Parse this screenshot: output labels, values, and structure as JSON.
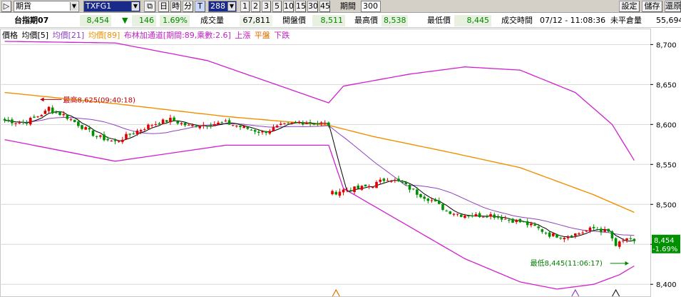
{
  "toolbar": {
    "market_select": "期貨",
    "symbol_select": "TXFG1",
    "interval_buttons": [
      "日",
      "時",
      "分",
      "T"
    ],
    "tick_select": "288",
    "minute_buttons": [
      "1",
      "2",
      "3",
      "5",
      "10",
      "15",
      "30",
      "45"
    ],
    "period_label": "期間",
    "period_value": "300",
    "right_buttons": [
      "設定",
      "儲存",
      "還原"
    ]
  },
  "quote": {
    "name": "台指期07",
    "price": "8,454",
    "change_arrow": "▼",
    "change": "146",
    "change_pct": "1.69%",
    "volume_label": "成交量",
    "volume": "67,811",
    "open_label": "開盤價",
    "open": "8,511",
    "high_label": "最高價",
    "high": "8,538",
    "low_label": "最低價",
    "low": "8,445",
    "time_label": "成交時間",
    "time": "07/12 - 11:08:36",
    "oi_label": "未平倉量",
    "oi": "55,694"
  },
  "legend": {
    "price": "價格",
    "ma5": "均價[5]",
    "ma21": "均價[21]",
    "ma89": "均價[89]",
    "bollinger": "布林加通道[期間:89,乘數:2.6]",
    "up": "上漲",
    "flat": "平盤",
    "down": "下跌"
  },
  "colors": {
    "up": "#e00000",
    "down": "#009000",
    "ma5": "#000000",
    "ma21": "#9040c0",
    "ma89": "#f09000",
    "bollinger": "#d020d0",
    "flat": "#e07000",
    "high_annotation": "#c00000",
    "low_annotation": "#008000",
    "grid": "#d8d8d8",
    "last_price_bg": "#009000"
  },
  "chart_data": {
    "type": "candlestick",
    "y_axis_ticks": [
      "8,700",
      "8,650",
      "8,600",
      "8,550",
      "8,500",
      "8,450",
      "8,400"
    ],
    "ylim": [
      8385,
      8720
    ],
    "gap_index": 89,
    "count": 172,
    "last_price_label": "8,454",
    "last_change_label": "-1.69%",
    "high_annotation": "最高8,625(09:40:18)",
    "high_index": 12,
    "high_value": 8625,
    "low_annotation": "最低8,445(11:06:17)",
    "low_index": 166,
    "low_value": 8445,
    "close_anchors": [
      [
        0,
        8605
      ],
      [
        5,
        8602
      ],
      [
        8,
        8608
      ],
      [
        12,
        8618
      ],
      [
        16,
        8612
      ],
      [
        20,
        8600
      ],
      [
        25,
        8585
      ],
      [
        30,
        8578
      ],
      [
        35,
        8590
      ],
      [
        40,
        8600
      ],
      [
        45,
        8606
      ],
      [
        50,
        8598
      ],
      [
        55,
        8600
      ],
      [
        60,
        8602
      ],
      [
        65,
        8596
      ],
      [
        70,
        8590
      ],
      [
        75,
        8598
      ],
      [
        80,
        8603
      ],
      [
        85,
        8602
      ],
      [
        88,
        8600
      ],
      [
        89,
        8514
      ],
      [
        92,
        8518
      ],
      [
        96,
        8520
      ],
      [
        100,
        8524
      ],
      [
        104,
        8533
      ],
      [
        108,
        8526
      ],
      [
        112,
        8514
      ],
      [
        116,
        8505
      ],
      [
        120,
        8492
      ],
      [
        124,
        8487
      ],
      [
        128,
        8486
      ],
      [
        132,
        8487
      ],
      [
        136,
        8482
      ],
      [
        140,
        8478
      ],
      [
        144,
        8472
      ],
      [
        148,
        8462
      ],
      [
        152,
        8460
      ],
      [
        156,
        8464
      ],
      [
        160,
        8470
      ],
      [
        164,
        8465
      ],
      [
        166,
        8450
      ],
      [
        168,
        8455
      ],
      [
        171,
        8454
      ]
    ],
    "ma89_anchors": [
      [
        0,
        8640
      ],
      [
        30,
        8626
      ],
      [
        60,
        8610
      ],
      [
        88,
        8599
      ],
      [
        100,
        8585
      ],
      [
        120,
        8566
      ],
      [
        140,
        8546
      ],
      [
        160,
        8512
      ],
      [
        171,
        8490
      ]
    ],
    "bollinger_upper_anchors": [
      [
        0,
        8704
      ],
      [
        30,
        8702
      ],
      [
        55,
        8680
      ],
      [
        88,
        8627
      ],
      [
        92,
        8648
      ],
      [
        110,
        8663
      ],
      [
        125,
        8672
      ],
      [
        140,
        8668
      ],
      [
        155,
        8640
      ],
      [
        165,
        8600
      ],
      [
        171,
        8555
      ]
    ],
    "bollinger_lower_anchors": [
      [
        0,
        8581
      ],
      [
        30,
        8554
      ],
      [
        60,
        8574
      ],
      [
        88,
        8574
      ],
      [
        92,
        8520
      ],
      [
        110,
        8472
      ],
      [
        125,
        8432
      ],
      [
        140,
        8403
      ],
      [
        150,
        8394
      ],
      [
        160,
        8400
      ],
      [
        167,
        8412
      ],
      [
        171,
        8423
      ]
    ],
    "volume_markers": [
      {
        "index": 90,
        "kind": "up"
      },
      {
        "index": 155,
        "kind": "flat"
      },
      {
        "index": 166,
        "kind": "down"
      }
    ]
  }
}
